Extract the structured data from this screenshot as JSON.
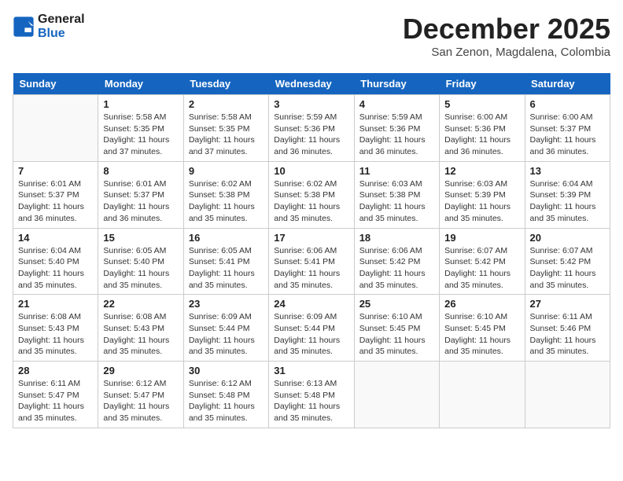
{
  "logo": {
    "line1": "General",
    "line2": "Blue"
  },
  "title": "December 2025",
  "subtitle": "San Zenon, Magdalena, Colombia",
  "weekdays": [
    "Sunday",
    "Monday",
    "Tuesday",
    "Wednesday",
    "Thursday",
    "Friday",
    "Saturday"
  ],
  "weeks": [
    [
      {
        "date": "",
        "sunrise": "",
        "sunset": "",
        "daylight": ""
      },
      {
        "date": "1",
        "sunrise": "5:58 AM",
        "sunset": "5:35 PM",
        "daylight": "11 hours and 37 minutes."
      },
      {
        "date": "2",
        "sunrise": "5:58 AM",
        "sunset": "5:35 PM",
        "daylight": "11 hours and 37 minutes."
      },
      {
        "date": "3",
        "sunrise": "5:59 AM",
        "sunset": "5:36 PM",
        "daylight": "11 hours and 36 minutes."
      },
      {
        "date": "4",
        "sunrise": "5:59 AM",
        "sunset": "5:36 PM",
        "daylight": "11 hours and 36 minutes."
      },
      {
        "date": "5",
        "sunrise": "6:00 AM",
        "sunset": "5:36 PM",
        "daylight": "11 hours and 36 minutes."
      },
      {
        "date": "6",
        "sunrise": "6:00 AM",
        "sunset": "5:37 PM",
        "daylight": "11 hours and 36 minutes."
      }
    ],
    [
      {
        "date": "7",
        "sunrise": "6:01 AM",
        "sunset": "5:37 PM",
        "daylight": "11 hours and 36 minutes."
      },
      {
        "date": "8",
        "sunrise": "6:01 AM",
        "sunset": "5:37 PM",
        "daylight": "11 hours and 36 minutes."
      },
      {
        "date": "9",
        "sunrise": "6:02 AM",
        "sunset": "5:38 PM",
        "daylight": "11 hours and 35 minutes."
      },
      {
        "date": "10",
        "sunrise": "6:02 AM",
        "sunset": "5:38 PM",
        "daylight": "11 hours and 35 minutes."
      },
      {
        "date": "11",
        "sunrise": "6:03 AM",
        "sunset": "5:38 PM",
        "daylight": "11 hours and 35 minutes."
      },
      {
        "date": "12",
        "sunrise": "6:03 AM",
        "sunset": "5:39 PM",
        "daylight": "11 hours and 35 minutes."
      },
      {
        "date": "13",
        "sunrise": "6:04 AM",
        "sunset": "5:39 PM",
        "daylight": "11 hours and 35 minutes."
      }
    ],
    [
      {
        "date": "14",
        "sunrise": "6:04 AM",
        "sunset": "5:40 PM",
        "daylight": "11 hours and 35 minutes."
      },
      {
        "date": "15",
        "sunrise": "6:05 AM",
        "sunset": "5:40 PM",
        "daylight": "11 hours and 35 minutes."
      },
      {
        "date": "16",
        "sunrise": "6:05 AM",
        "sunset": "5:41 PM",
        "daylight": "11 hours and 35 minutes."
      },
      {
        "date": "17",
        "sunrise": "6:06 AM",
        "sunset": "5:41 PM",
        "daylight": "11 hours and 35 minutes."
      },
      {
        "date": "18",
        "sunrise": "6:06 AM",
        "sunset": "5:42 PM",
        "daylight": "11 hours and 35 minutes."
      },
      {
        "date": "19",
        "sunrise": "6:07 AM",
        "sunset": "5:42 PM",
        "daylight": "11 hours and 35 minutes."
      },
      {
        "date": "20",
        "sunrise": "6:07 AM",
        "sunset": "5:42 PM",
        "daylight": "11 hours and 35 minutes."
      }
    ],
    [
      {
        "date": "21",
        "sunrise": "6:08 AM",
        "sunset": "5:43 PM",
        "daylight": "11 hours and 35 minutes."
      },
      {
        "date": "22",
        "sunrise": "6:08 AM",
        "sunset": "5:43 PM",
        "daylight": "11 hours and 35 minutes."
      },
      {
        "date": "23",
        "sunrise": "6:09 AM",
        "sunset": "5:44 PM",
        "daylight": "11 hours and 35 minutes."
      },
      {
        "date": "24",
        "sunrise": "6:09 AM",
        "sunset": "5:44 PM",
        "daylight": "11 hours and 35 minutes."
      },
      {
        "date": "25",
        "sunrise": "6:10 AM",
        "sunset": "5:45 PM",
        "daylight": "11 hours and 35 minutes."
      },
      {
        "date": "26",
        "sunrise": "6:10 AM",
        "sunset": "5:45 PM",
        "daylight": "11 hours and 35 minutes."
      },
      {
        "date": "27",
        "sunrise": "6:11 AM",
        "sunset": "5:46 PM",
        "daylight": "11 hours and 35 minutes."
      }
    ],
    [
      {
        "date": "28",
        "sunrise": "6:11 AM",
        "sunset": "5:47 PM",
        "daylight": "11 hours and 35 minutes."
      },
      {
        "date": "29",
        "sunrise": "6:12 AM",
        "sunset": "5:47 PM",
        "daylight": "11 hours and 35 minutes."
      },
      {
        "date": "30",
        "sunrise": "6:12 AM",
        "sunset": "5:48 PM",
        "daylight": "11 hours and 35 minutes."
      },
      {
        "date": "31",
        "sunrise": "6:13 AM",
        "sunset": "5:48 PM",
        "daylight": "11 hours and 35 minutes."
      },
      {
        "date": "",
        "sunrise": "",
        "sunset": "",
        "daylight": ""
      },
      {
        "date": "",
        "sunrise": "",
        "sunset": "",
        "daylight": ""
      },
      {
        "date": "",
        "sunrise": "",
        "sunset": "",
        "daylight": ""
      }
    ]
  ]
}
